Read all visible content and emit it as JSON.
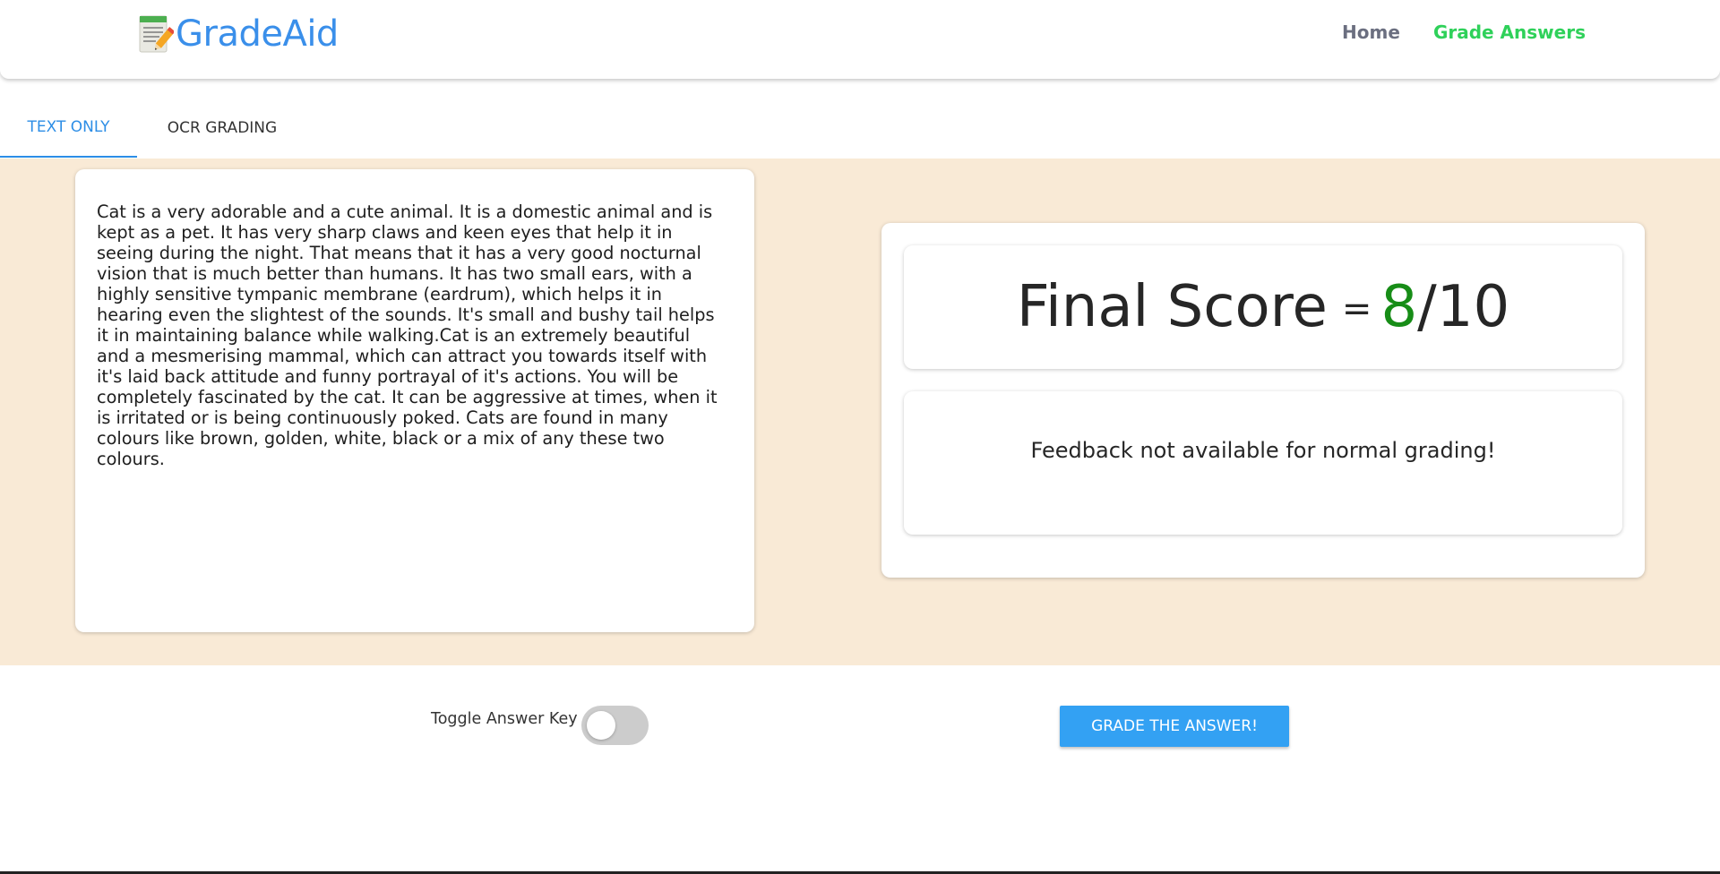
{
  "header": {
    "logo_text": "GradeAid",
    "nav": {
      "home": "Home",
      "grade_answers": "Grade Answers"
    },
    "colors": {
      "logo": "#3a8fea",
      "active_nav": "#2fd15a"
    }
  },
  "tabs": [
    {
      "label": "TEXT ONLY",
      "active": true
    },
    {
      "label": "OCR GRADING",
      "active": false
    }
  ],
  "answer": {
    "text": "Cat is a very adorable and a cute animal. It is a domestic animal and is kept as a pet. It has very sharp claws and keen eyes that help it in seeing during the night. That means that it has a very good nocturnal vision that is much better than humans. It has two small ears, with a highly sensitive tympanic membrane (eardrum), which helps it in hearing even the slightest of the sounds. It's small and bushy tail helps it in maintaining balance while walking.Cat is an extremely beautiful and a mesmerising mammal, which can attract you towards itself with it's laid back attitude and funny portrayal of it's actions. You will be completely fascinated by the cat. It can be aggressive at times, when it is irritated or is being continuously poked. Cats are found in many colours like brown, golden, white, black or a mix of any these two colours."
  },
  "result": {
    "score_label": "Final Score",
    "equals": "=",
    "score": "8",
    "separator": "/",
    "max_score": "10",
    "score_color": "#178d17",
    "feedback": "Feedback not available for normal grading!"
  },
  "controls": {
    "toggle_label": "Toggle Answer Key",
    "toggle_on": false,
    "grade_button": "GRADE THE ANSWER!",
    "grade_button_color": "#33a1f3"
  },
  "icons": {
    "logo": "memo-pencil-icon"
  },
  "theme": {
    "band_background": "#f9ead6"
  }
}
